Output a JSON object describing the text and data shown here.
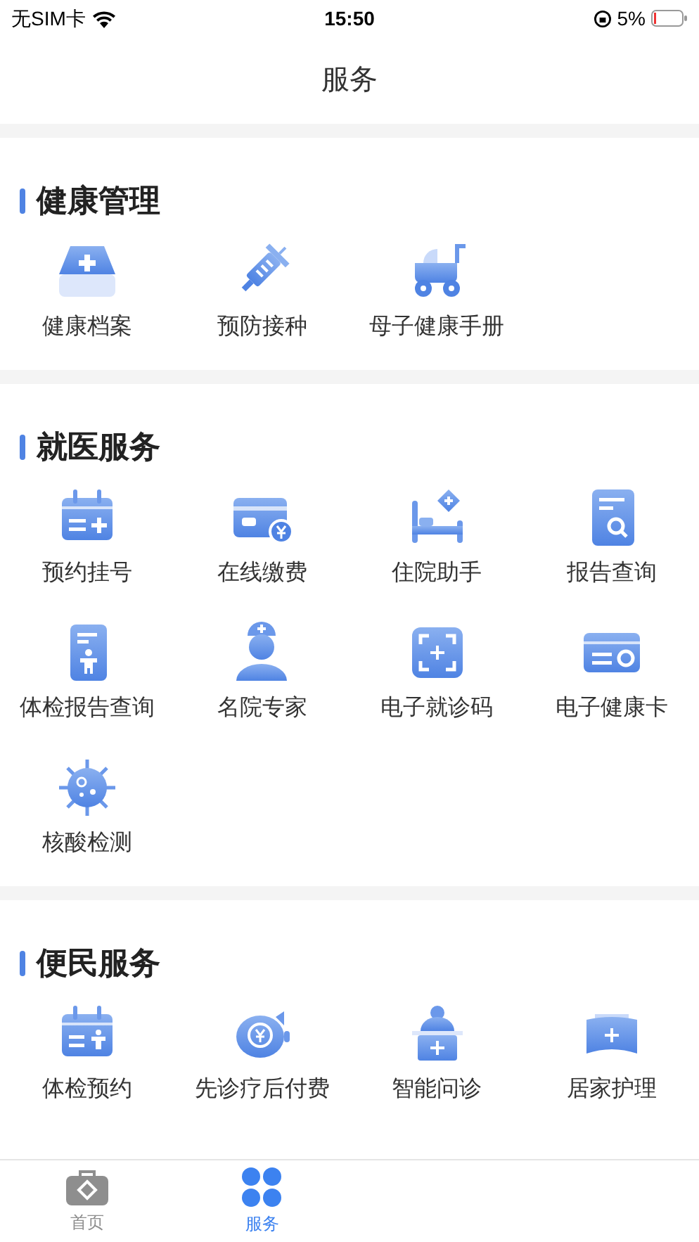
{
  "status_bar": {
    "carrier": "无SIM卡",
    "time": "15:50",
    "battery": "5%"
  },
  "title": "服务",
  "sections": [
    {
      "title": "健康管理",
      "items": [
        {
          "label": "健康档案"
        },
        {
          "label": "预防接种"
        },
        {
          "label": "母子健康手册"
        }
      ]
    },
    {
      "title": "就医服务",
      "items": [
        {
          "label": "预约挂号"
        },
        {
          "label": "在线缴费"
        },
        {
          "label": "住院助手"
        },
        {
          "label": "报告查询"
        },
        {
          "label": "体检报告查询"
        },
        {
          "label": "名院专家"
        },
        {
          "label": "电子就诊码"
        },
        {
          "label": "电子健康卡"
        },
        {
          "label": "核酸检测"
        }
      ]
    },
    {
      "title": "便民服务",
      "items": [
        {
          "label": "体检预约"
        },
        {
          "label": "先诊疗后付费"
        },
        {
          "label": "智能问诊"
        },
        {
          "label": "居家护理"
        }
      ]
    }
  ],
  "tab_bar": [
    {
      "label": "首页",
      "selected": false
    },
    {
      "label": "服务",
      "selected": true
    }
  ]
}
